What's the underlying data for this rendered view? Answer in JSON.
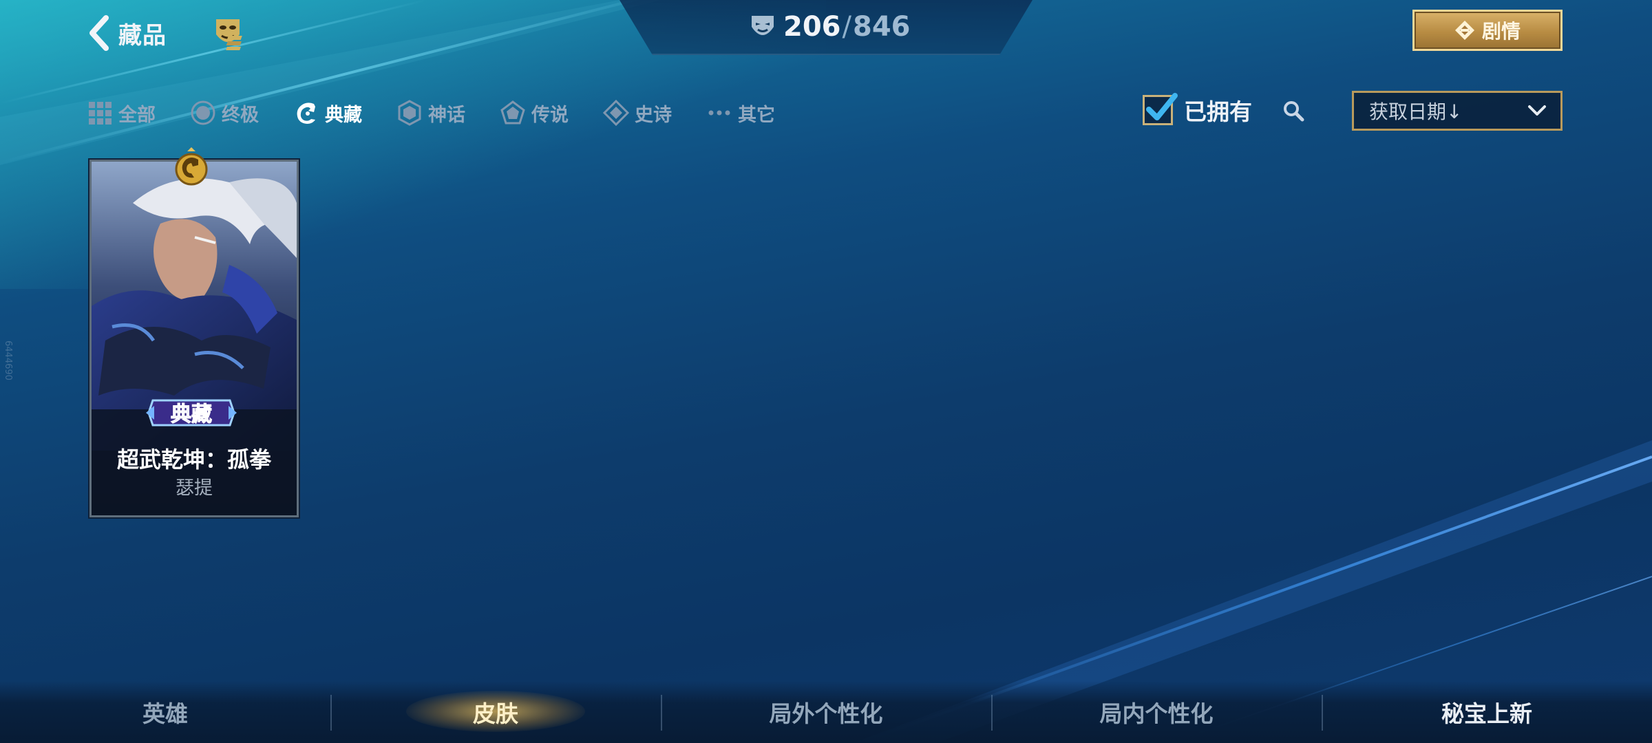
{
  "header": {
    "back_label": "藏品",
    "count_owned": "206",
    "count_separator": "/",
    "count_total": "846",
    "story_label": "剧情"
  },
  "filters": {
    "tiers": [
      {
        "label": "全部",
        "icon": "grid-icon",
        "active": false
      },
      {
        "label": "终极",
        "icon": "circle-gem-icon",
        "active": false
      },
      {
        "label": "典藏",
        "icon": "dragon-icon",
        "active": true
      },
      {
        "label": "神话",
        "icon": "hexagon-icon",
        "active": false
      },
      {
        "label": "传说",
        "icon": "pentagon-icon",
        "active": false
      },
      {
        "label": "史诗",
        "icon": "diamond-icon",
        "active": false
      },
      {
        "label": "其它",
        "icon": "dots-icon",
        "active": false
      }
    ],
    "owned_label": "已拥有",
    "owned_checked": true,
    "sort_value": "获取日期↓"
  },
  "cards": [
    {
      "skin_name": "超武乾坤：孤拳",
      "hero_name": "瑟提",
      "tier_badge": "典藏"
    }
  ],
  "bottom_nav": [
    {
      "label": "英雄",
      "active": false
    },
    {
      "label": "皮肤",
      "active": true
    },
    {
      "label": "局外个性化",
      "active": false
    },
    {
      "label": "局内个性化",
      "active": false
    },
    {
      "label": "秘宝上新",
      "active": false
    }
  ],
  "side_text": "6444690",
  "colors": {
    "accent_gold": "#c9a862",
    "checkbox_tick": "#3fb6f0",
    "background": "#0f4d80"
  }
}
